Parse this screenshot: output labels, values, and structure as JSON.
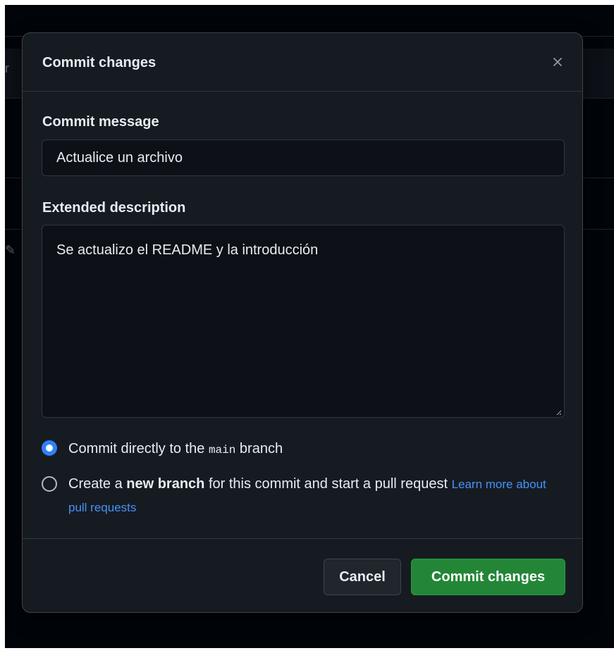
{
  "dialog": {
    "title": "Commit changes",
    "close_icon": "close-icon"
  },
  "commit_message": {
    "label": "Commit message",
    "value": "Actualice un archivo"
  },
  "extended_description": {
    "label": "Extended description",
    "value": "Se actualizo el README y la introducción"
  },
  "branch_options": {
    "direct": {
      "selected": true,
      "text_before": "Commit directly to the ",
      "branch_name": "main",
      "text_after": " branch"
    },
    "new_branch": {
      "selected": false,
      "text_before": "Create a ",
      "bold_text": "new branch",
      "text_after": " for this commit and start a pull request ",
      "link_text": "Learn more about pull requests"
    }
  },
  "footer": {
    "cancel_label": "Cancel",
    "commit_label": "Commit changes"
  },
  "colors": {
    "primary_button": "#238636",
    "link": "#4493f8",
    "radio_selected": "#2f81f7",
    "dialog_background": "#161b22"
  }
}
